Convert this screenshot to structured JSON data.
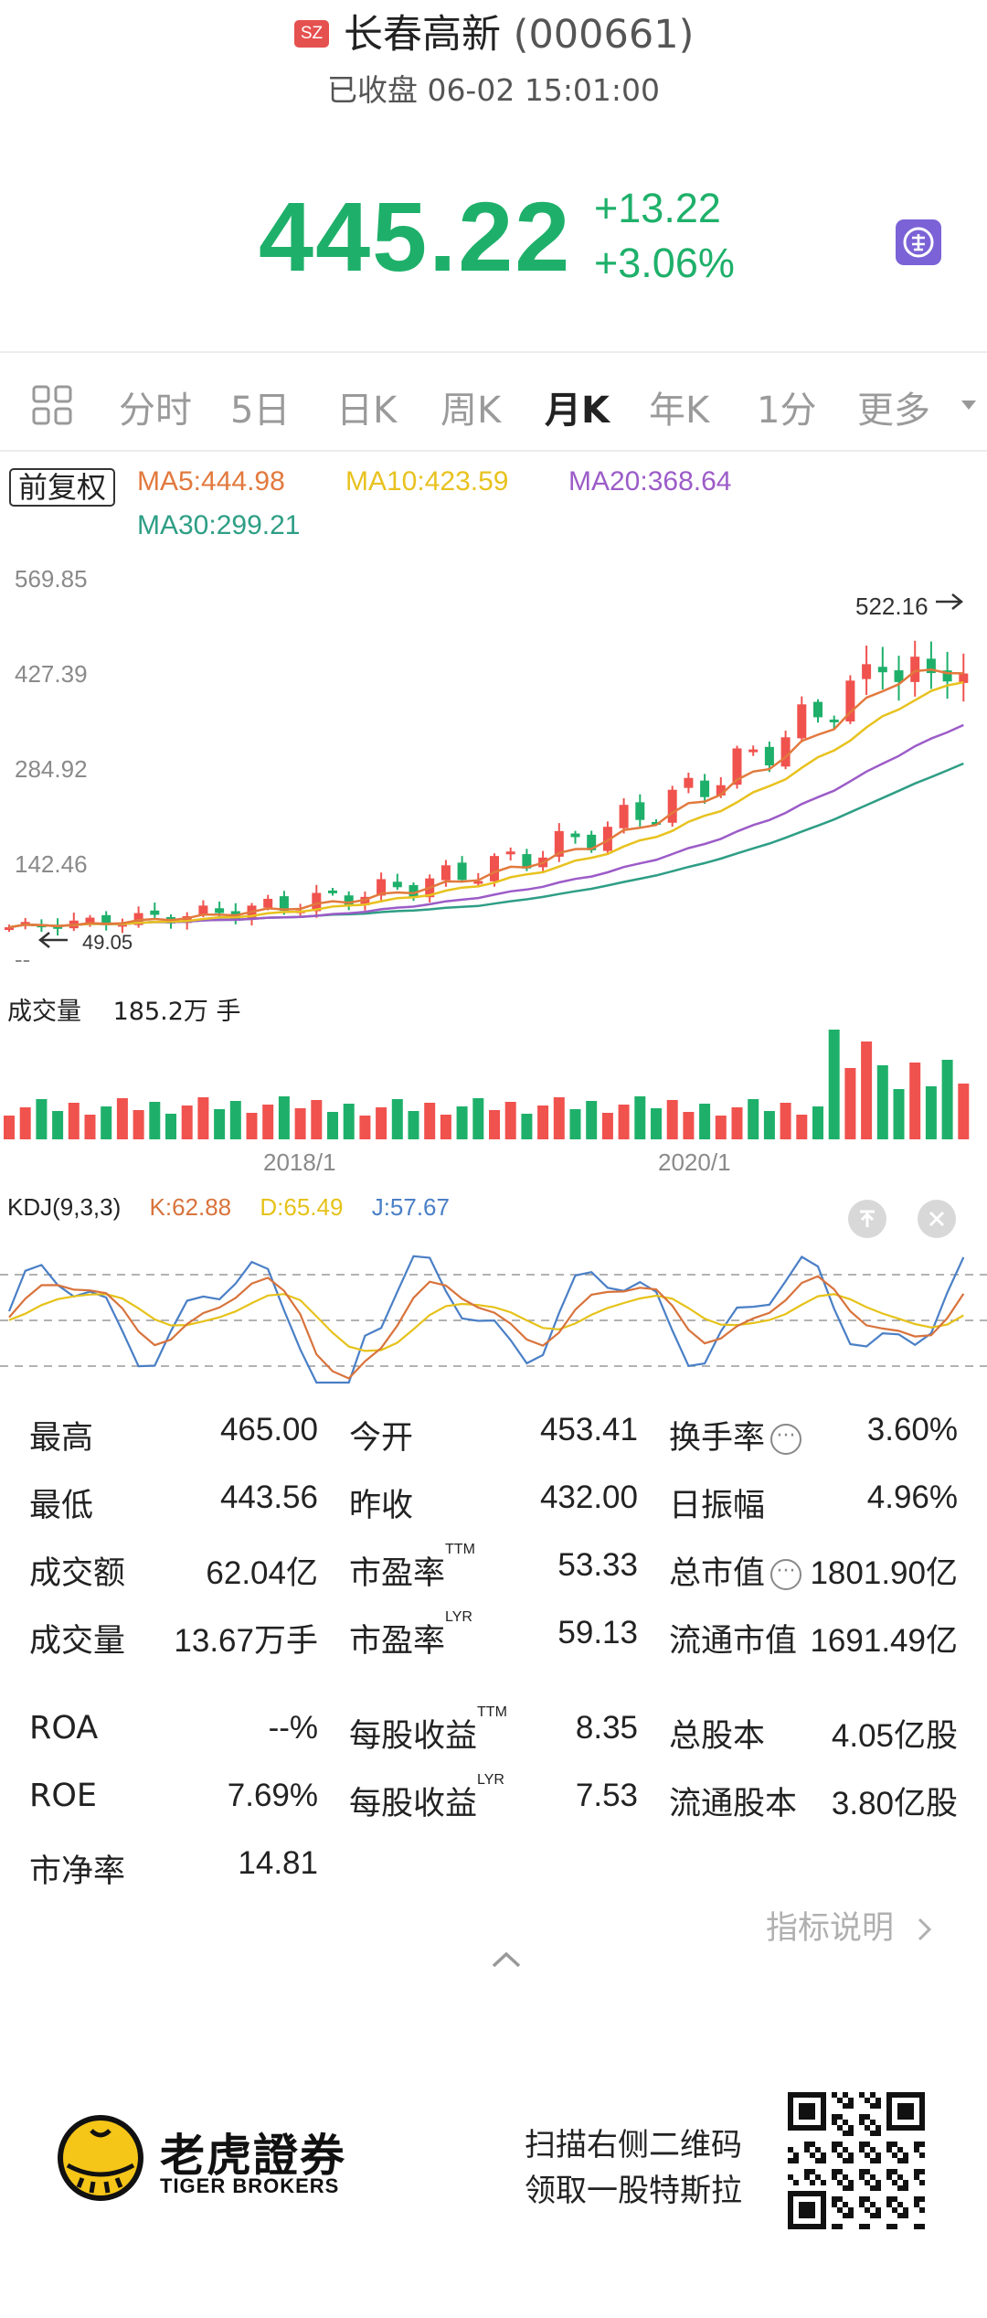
{
  "header": {
    "exchange_badge": "SZ",
    "stock_name": "长春高新",
    "stock_code": "(000661)",
    "status": "已收盘 06-02 15:01:00",
    "price": "445.22",
    "change": "+13.22",
    "change_pct": "+3.06%",
    "buy_icon": "buy-badge-icon"
  },
  "tabs": [
    {
      "label": "分时"
    },
    {
      "label": "5日"
    },
    {
      "label": "日K"
    },
    {
      "label": "周K"
    },
    {
      "label": "月K",
      "active": true
    },
    {
      "label": "年K"
    },
    {
      "label": "1分"
    },
    {
      "label": "更多"
    }
  ],
  "legend": {
    "adjust": "前复权",
    "ma5": "MA5:444.98",
    "ma10": "MA10:423.59",
    "ma20": "MA20:368.64",
    "ma30": "MA30:299.21"
  },
  "price_axis": [
    "569.85",
    "427.39",
    "284.92",
    "142.46",
    "--"
  ],
  "markers": {
    "high": "522.16",
    "low": "49.05"
  },
  "volume": {
    "title": "成交量",
    "value": "185.2万 手"
  },
  "dates": [
    "2018/1",
    "2020/1"
  ],
  "kdj": {
    "title": "KDJ(9,3,3)",
    "k": "K:62.88",
    "d": "D:65.49",
    "j": "J:57.67"
  },
  "colors": {
    "up": "#f0524e",
    "down": "#1eb06a",
    "ma5": "#e2793d",
    "ma10": "#e8c21f",
    "ma20": "#9c5cc8",
    "ma30": "#2e9e85",
    "kdj_k": "#d8733c",
    "kdj_d": "#e6c21a",
    "kdj_j": "#4a7fc6"
  },
  "stats": [
    [
      {
        "label": "最高",
        "value": "465.00"
      },
      {
        "label": "今开",
        "value": "453.41"
      },
      {
        "label": "换手率",
        "value": "3.60%",
        "info": true
      }
    ],
    [
      {
        "label": "最低",
        "value": "443.56"
      },
      {
        "label": "昨收",
        "value": "432.00"
      },
      {
        "label": "日振幅",
        "value": "4.96%"
      }
    ],
    [
      {
        "label": "成交额",
        "value": "62.04亿"
      },
      {
        "label": "市盈率",
        "sup": "TTM",
        "value": "53.33"
      },
      {
        "label": "总市值",
        "value": "1801.90亿",
        "info": true
      }
    ],
    [
      {
        "label": "成交量",
        "value": "13.67万手"
      },
      {
        "label": "市盈率",
        "sup": "LYR",
        "value": "59.13"
      },
      {
        "label": "流通市值",
        "value": "1691.49亿"
      }
    ],
    [
      {
        "label": "ROA",
        "value": "--%"
      },
      {
        "label": "每股收益",
        "sup": "TTM",
        "value": "8.35"
      },
      {
        "label": "总股本",
        "value": "4.05亿股"
      }
    ],
    [
      {
        "label": "ROE",
        "value": "7.69%"
      },
      {
        "label": "每股收益",
        "sup": "LYR",
        "value": "7.53"
      },
      {
        "label": "流通股本",
        "value": "3.80亿股"
      }
    ],
    [
      {
        "label": "市净率",
        "value": "14.81"
      }
    ]
  ],
  "more_link": "指标说明",
  "footer": {
    "brand_cn": "老虎證券",
    "brand_en": "TIGER BROKERS",
    "promo_line1": "扫描右侧二维码",
    "promo_line2": "领取一股特斯拉"
  }
}
